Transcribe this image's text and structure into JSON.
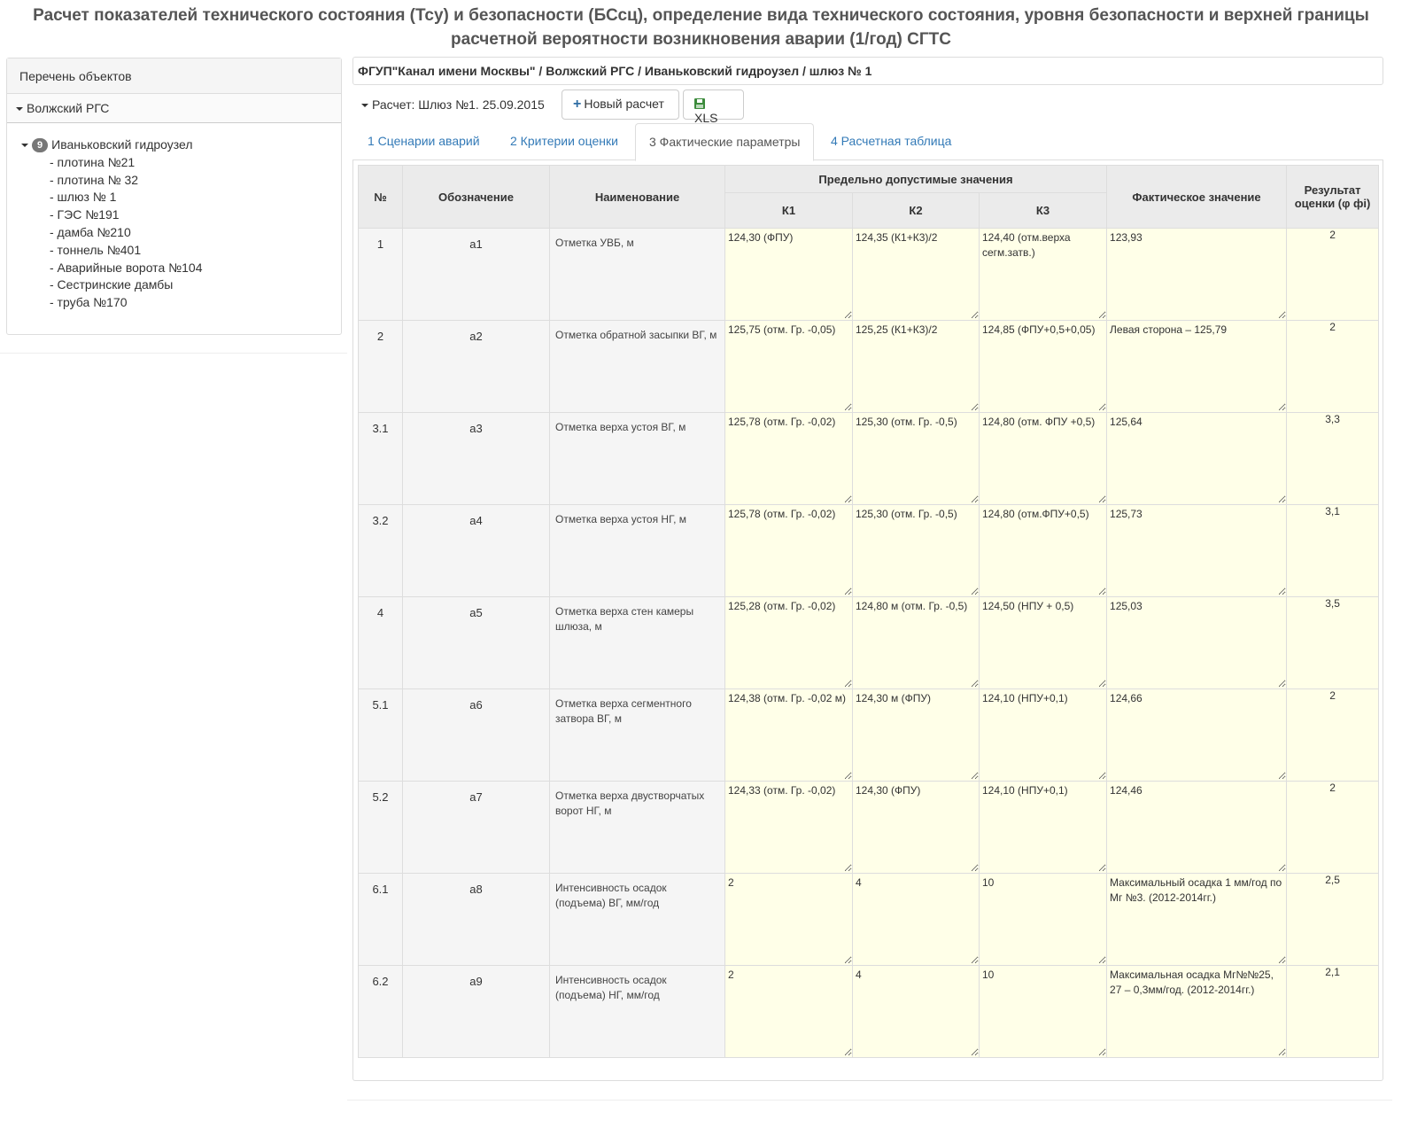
{
  "page_title": "Расчет показателей технического состояния (Тсу) и безопасности (БСсц), определение вида технического состояния, уровня безопасности и верхней границы расчетной вероятности возникновения аварии (1/год) СГТС",
  "sidebar": {
    "header": "Перечень объектов",
    "region": "Волжский РГС",
    "node": {
      "badge": "9",
      "label": "Иваньковский гидроузел"
    },
    "items": [
      "- плотина №21",
      "- плотина № 32",
      "- шлюз № 1",
      "- ГЭС №191",
      "- дамба №210",
      "- тоннель №401",
      "- Аварийные ворота №104",
      "- Сестринские дамбы",
      "- труба №170"
    ]
  },
  "breadcrumb": "ФГУП\"Канал имени Москвы\" / Волжский РГС / Иваньковский гидроузел / шлюз № 1",
  "toolbar": {
    "calc_label": "Расчет: Шлюз №1. 25.09.2015",
    "new_calc_label": "Новый расчет",
    "xls_label": "XLS"
  },
  "tabs": [
    "1 Сценарии аварий",
    "2 Критерии оценки",
    "3 Фактические параметры",
    "4 Расчетная таблица"
  ],
  "active_tab_index": 2,
  "table": {
    "headers": {
      "num": "№",
      "code": "Обозначение",
      "name": "Наименование",
      "limits": "Предельно допустимые значения",
      "k1": "К1",
      "k2": "К2",
      "k3": "К3",
      "actual": "Фактическое значение",
      "result": "Результат оценки (φ фi)"
    },
    "rows": [
      {
        "num": "1",
        "code": "а1",
        "name": "Отметка УВБ, м",
        "k1": "124,30 (ФПУ)",
        "k2": "124,35 (К1+К3)/2",
        "k3": "124,40 (отм.верха сегм.затв.)",
        "actual": "123,93",
        "result": "2"
      },
      {
        "num": "2",
        "code": "а2",
        "name": "Отметка обратной засыпки ВГ, м",
        "k1": "125,75 (отм. Гр. -0,05)",
        "k2": "125,25 (К1+К3)/2",
        "k3": "124,85 (ФПУ+0,5+0,05)",
        "actual": "Левая сторона – 125,79",
        "result": "2"
      },
      {
        "num": "3.1",
        "code": "а3",
        "name": "Отметка верха устоя ВГ, м",
        "k1": "125,78 (отм. Гр. -0,02)",
        "k2": "125,30 (отм. Гр. -0,5)",
        "k3": "124,80 (отм. ФПУ +0,5)",
        "actual": "125,64",
        "result": "3,3"
      },
      {
        "num": "3.2",
        "code": "а4",
        "name": "Отметка верха устоя НГ, м",
        "k1": "125,78 (отм. Гр. -0,02)",
        "k2": "125,30 (отм. Гр. -0,5)",
        "k3": "124,80 (отм.ФПУ+0,5)",
        "actual": "125,73",
        "result": "3,1"
      },
      {
        "num": "4",
        "code": "а5",
        "name": "Отметка верха стен камеры шлюза, м",
        "k1": "125,28 (отм. Гр. -0,02)",
        "k2": "124,80 м (отм. Гр. -0,5)",
        "k3": "124,50 (НПУ + 0,5)",
        "actual": "125,03",
        "result": "3,5"
      },
      {
        "num": "5.1",
        "code": "а6",
        "name": "Отметка верха сегментного затвора ВГ, м",
        "k1": "124,38 (отм. Гр. -0,02 м)",
        "k2": "124,30 м (ФПУ)",
        "k3": "124,10 (НПУ+0,1)",
        "actual": "124,66",
        "result": "2"
      },
      {
        "num": "5.2",
        "code": "а7",
        "name": "Отметка верха двустворчатых ворот НГ, м",
        "k1": "124,33 (отм. Гр. -0,02)",
        "k2": "124,30 (ФПУ)",
        "k3": "124,10 (НПУ+0,1)",
        "actual": "124,46",
        "result": "2"
      },
      {
        "num": "6.1",
        "code": "а8",
        "name": "Интенсивность осадок (подъема) ВГ, мм/год",
        "k1": "2",
        "k2": "4",
        "k3": "10",
        "actual": "Максимальный осадка 1 мм/год по Мг №3. (2012-2014гг.)",
        "result": "2,5"
      },
      {
        "num": "6.2",
        "code": "а9",
        "name": "Интенсивность осадок (подъема) НГ, мм/год",
        "k1": "2",
        "k2": "4",
        "k3": "10",
        "actual": "Максимальная осадка Мг№№25, 27 – 0,3мм/год. (2012-2014гг.)",
        "result": "2,1"
      }
    ]
  },
  "colors": {
    "field_bg": "#ffffe8",
    "header_bg": "#ebebeb",
    "link": "#337ab7",
    "badge": "#777777",
    "floppy": "#3c8b3c"
  }
}
